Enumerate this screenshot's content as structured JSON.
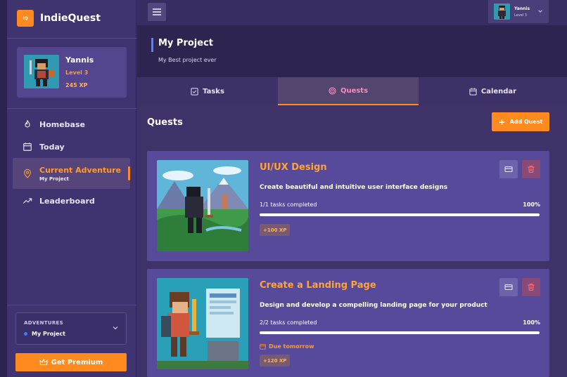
{
  "brand": {
    "logo_text": "IQ",
    "name": "IndieQuest"
  },
  "profile": {
    "name": "Yannis",
    "level": "Level 3",
    "xp": "245 XP"
  },
  "nav": {
    "items": [
      {
        "label": "Homebase",
        "icon": "flame-icon"
      },
      {
        "label": "Today",
        "icon": "calendar-icon"
      },
      {
        "label": "Current Adventure",
        "sub": "My Project",
        "icon": "location-pin-icon"
      },
      {
        "label": "Leaderboard",
        "icon": "trending-up-icon"
      }
    ]
  },
  "adventures": {
    "title": "ADVENTURES",
    "selected": "My Project"
  },
  "premium": {
    "label": "Get Premium"
  },
  "user_chip": {
    "name": "Yannis",
    "level": "Level 3"
  },
  "project": {
    "title": "My Project",
    "subtitle": "My Best project ever"
  },
  "tabs": [
    {
      "label": "Tasks",
      "active": false
    },
    {
      "label": "Quests",
      "active": true
    },
    {
      "label": "Calendar",
      "active": false
    }
  ],
  "quests_section": {
    "title": "Quests",
    "add_label": "Add Quest"
  },
  "quests": [
    {
      "title": "UI/UX Design",
      "description": "Create beautiful and intuitive user interface designs",
      "tasks": "1/1 tasks completed",
      "percent": "100%",
      "progress": 1.0,
      "xp": "+100 XP"
    },
    {
      "title": "Create a Landing Page",
      "description": "Design and develop a compelling landing page for your product",
      "tasks": "2/2 tasks completed",
      "percent": "100%",
      "progress": 1.0,
      "due": "Due tomorrow",
      "xp": "+120 XP"
    }
  ],
  "colors": {
    "accent": "#ff8a1f",
    "card": "#574a9a",
    "sidebar": "#403470",
    "quest_title": "#ffa33a"
  }
}
